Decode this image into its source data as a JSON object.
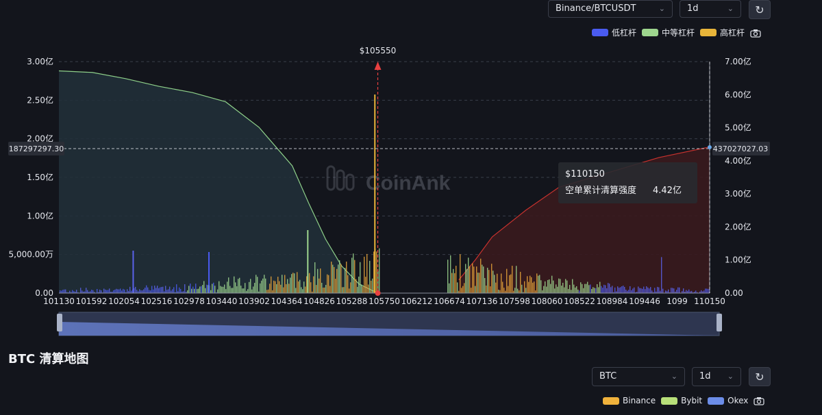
{
  "top_controls": {
    "exchange_select": "Binance/BTCUSDT",
    "interval_select": "1d",
    "legend": [
      {
        "label": "低杠杆",
        "color": "#4a5bf0"
      },
      {
        "label": "中等杠杆",
        "color": "#9ed68e"
      },
      {
        "label": "高杠杆",
        "color": "#e8b53a"
      }
    ]
  },
  "chart_data": {
    "type": "area",
    "current_price_label": "$105550",
    "current_price": 105550,
    "x_ticks": [
      "101130",
      "101592",
      "102054",
      "102516",
      "102978",
      "103440",
      "103902",
      "104364",
      "104826",
      "105288",
      "105750",
      "106212",
      "106674",
      "107136",
      "107598",
      "108060",
      "108522",
      "108984",
      "109446",
      "1099",
      "110150"
    ],
    "x_range": [
      101130,
      110150
    ],
    "left_axis": {
      "ticks": [
        "0.00",
        "5,000.00万",
        "1.00亿",
        "1.50亿",
        "2.00亿",
        "2.50亿",
        "3.00亿"
      ],
      "range": [
        0,
        300000000
      ]
    },
    "right_axis": {
      "ticks": [
        "0.00",
        "1.00亿",
        "2.00亿",
        "3.00亿",
        "4.00亿",
        "5.00亿",
        "6.00亿",
        "7.00亿"
      ],
      "range": [
        0,
        700000000
      ]
    },
    "crosshair": {
      "left_label": "187297297.30",
      "right_label": "437027027.03",
      "price": 110150
    },
    "long_cumulative": {
      "color": "#8fd18a",
      "x": [
        101130,
        101592,
        102054,
        102516,
        102978,
        103440,
        103902,
        104364,
        104600,
        104826,
        105050,
        105288,
        105550
      ],
      "y": [
        288000000,
        286000000,
        278000000,
        268000000,
        260000000,
        248000000,
        215000000,
        165000000,
        115000000,
        70000000,
        35000000,
        12000000,
        0
      ]
    },
    "short_cumulative": {
      "color": "#c8322e",
      "x": [
        106674,
        106900,
        107136,
        107598,
        108060,
        108522,
        108984,
        109446,
        110150
      ],
      "y": [
        40000000,
        100000000,
        170000000,
        250000000,
        320000000,
        350000000,
        380000000,
        410000000,
        442000000
      ]
    },
    "tooltip": {
      "price": "$110150",
      "label": "空单累计清算强度",
      "value": "4.42亿"
    }
  },
  "watermark": "CoinAnk",
  "section": {
    "title": "BTC 清算地图",
    "coin_select": "BTC",
    "interval_select": "1d",
    "legend": [
      {
        "label": "Binance",
        "color": "#f0b23c"
      },
      {
        "label": "Bybit",
        "color": "#b8e07a"
      },
      {
        "label": "Okex",
        "color": "#6c8de8"
      }
    ]
  }
}
